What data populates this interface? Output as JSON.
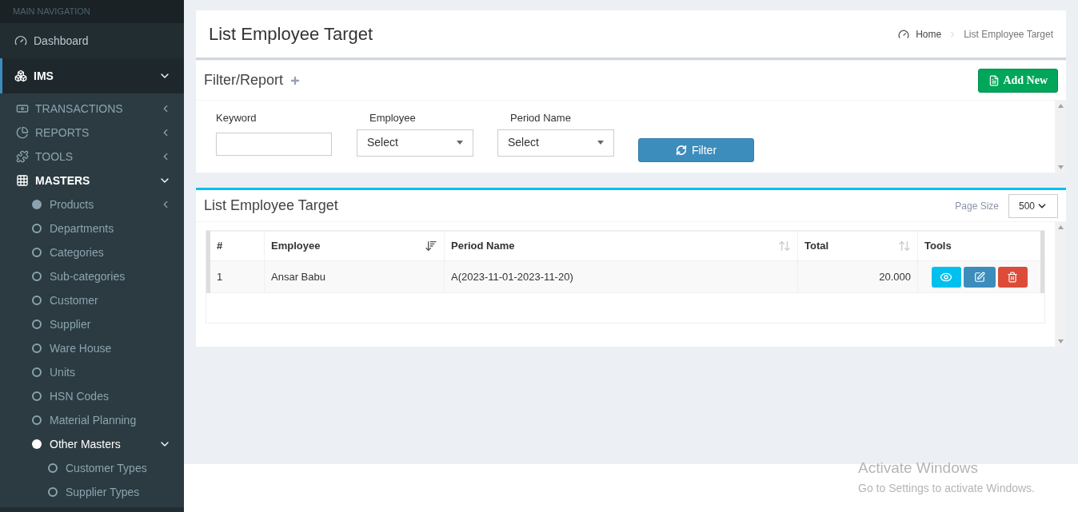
{
  "sidebar": {
    "header": "MAIN NAVIGATION",
    "items": [
      {
        "label": "Dashboard",
        "selected": false
      },
      {
        "label": "IMS",
        "selected": true,
        "expanded": true,
        "children": [
          {
            "label": "TRANSACTIONS",
            "selected": false,
            "expanded": false
          },
          {
            "label": "REPORTS",
            "selected": false,
            "expanded": false
          },
          {
            "label": "TOOLS",
            "selected": false,
            "expanded": false
          },
          {
            "label": "MASTERS",
            "selected": true,
            "expanded": true,
            "children": [
              {
                "label": "Products",
                "selected": false,
                "expanded": false
              },
              {
                "label": "Departments",
                "selected": false
              },
              {
                "label": "Categories",
                "selected": false
              },
              {
                "label": "Sub-categories",
                "selected": false
              },
              {
                "label": "Customer",
                "selected": false
              },
              {
                "label": "Supplier",
                "selected": false
              },
              {
                "label": "Ware House",
                "selected": false
              },
              {
                "label": "Units",
                "selected": false
              },
              {
                "label": "HSN Codes",
                "selected": false
              },
              {
                "label": "Material Planning",
                "selected": false
              },
              {
                "label": "Other Masters",
                "selected": true,
                "expanded": true,
                "children": [
                  {
                    "label": "Customer Types",
                    "selected": false
                  },
                  {
                    "label": "Supplier Types",
                    "selected": false
                  }
                ]
              }
            ]
          }
        ]
      }
    ]
  },
  "page": {
    "title": "List Employee Target",
    "breadcrumb": [
      "Home",
      "List Employee Target"
    ]
  },
  "filter_panel": {
    "title": "Filter/Report",
    "add_button": "Add New",
    "fields": [
      {
        "kind": "input",
        "label": "Keyword"
      },
      {
        "kind": "select",
        "label": "Employee",
        "value": "Select"
      },
      {
        "kind": "select",
        "label": "Period Name",
        "value": "Select"
      }
    ],
    "filter_button": "Filter"
  },
  "list_panel": {
    "title": "List Employee Target",
    "page_size_label": "Page Size",
    "page_size": "500",
    "table": {
      "columns": [
        {
          "label": "#"
        },
        {
          "label": "Employee",
          "sorted": true
        },
        {
          "label": "Period Name",
          "sorted": false
        },
        {
          "label": "Total",
          "sorted": false
        },
        {
          "label": "Tools"
        }
      ],
      "rows": [
        {
          "cells": [
            "1",
            "Ansar Babu",
            "A(2023-11-01-2023-11-20)",
            "20.000"
          ]
        }
      ]
    }
  },
  "os_notice": {
    "title": "Activate Windows",
    "text": "Go to Settings to activate Windows."
  }
}
